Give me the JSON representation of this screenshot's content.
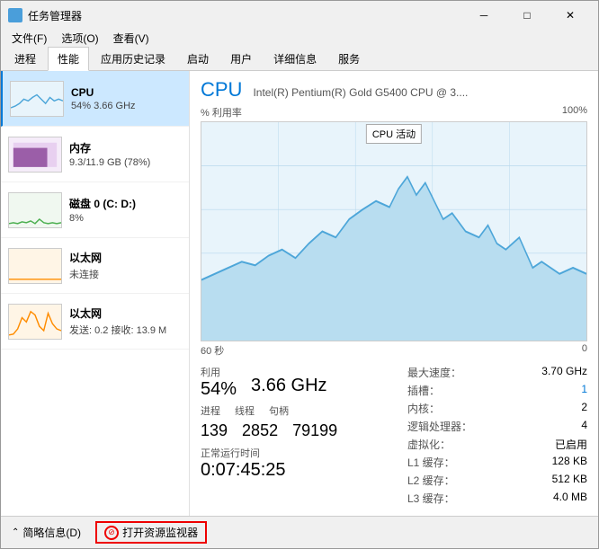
{
  "window": {
    "title": "任务管理器",
    "minimize_btn": "─",
    "maximize_btn": "□",
    "close_btn": "✕"
  },
  "menu": {
    "items": [
      "文件(F)",
      "选项(O)",
      "查看(V)"
    ]
  },
  "tabs": {
    "items": [
      "进程",
      "性能",
      "应用历史记录",
      "启动",
      "用户",
      "详细信息",
      "服务"
    ],
    "active": 1
  },
  "sidebar": {
    "items": [
      {
        "name": "CPU",
        "value": "54% 3.66 GHz",
        "type": "cpu"
      },
      {
        "name": "内存",
        "value": "9.3/11.9 GB (78%)",
        "type": "mem"
      },
      {
        "name": "磁盘 0 (C: D:)",
        "value": "8%",
        "type": "disk"
      },
      {
        "name": "以太网",
        "value": "未连接",
        "type": "net1"
      },
      {
        "name": "以太网",
        "value": "发送: 0.2  接收: 13.9 M",
        "type": "net2"
      }
    ]
  },
  "right_panel": {
    "title": "CPU",
    "subtitle": "Intel(R) Pentium(R) Gold G5400 CPU @ 3....",
    "chart_label_left": "% 利用率",
    "chart_label_right": "100%",
    "chart_time_left": "60 秒",
    "chart_time_right": "0",
    "tooltip_text": "CPU 活动",
    "stats": {
      "utilization_label": "利用",
      "utilization_value": "54%",
      "speed_label": "",
      "speed_value": "3.66 GHz",
      "process_label": "进程",
      "process_value": "139",
      "thread_label": "线程",
      "thread_value": "2852",
      "handle_label": "句柄",
      "handle_value": "79199",
      "uptime_label": "正常运行时间",
      "uptime_value": "0:07:45:25"
    },
    "right_stats": {
      "max_speed_label": "最大速度：",
      "max_speed_value": "3.70 GHz",
      "slot_label": "插槽：",
      "slot_value": "1",
      "core_label": "内核：",
      "core_value": "2",
      "logical_label": "逻辑处理器：",
      "logical_value": "4",
      "virt_label": "虚拟化：",
      "virt_value": "已启用",
      "l1_label": "L1 缓存：",
      "l1_value": "128 KB",
      "l2_label": "L2 缓存：",
      "l2_value": "512 KB",
      "l3_label": "L3 缓存：",
      "l3_value": "4.0 MB"
    }
  },
  "bottom": {
    "summary_label": "简略信息(D)",
    "open_monitor_label": "打开资源监视器"
  }
}
